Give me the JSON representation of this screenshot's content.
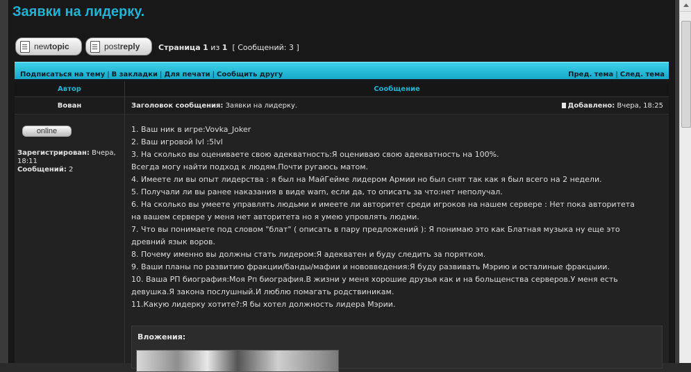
{
  "topic": {
    "title": "Заявки на лидерку."
  },
  "buttons": {
    "new_topic": {
      "prefix": "new",
      "bold": "topic"
    },
    "post_reply": {
      "prefix": "post",
      "bold": "reply"
    }
  },
  "pagination": {
    "page_word": "Страница",
    "current": "1",
    "of_word": "из",
    "total": "1",
    "messages": "[ Сообщений: 3 ]"
  },
  "navbar": {
    "left": [
      "Подписаться на тему",
      "В закладки",
      "Для печати",
      "Сообщить другу"
    ],
    "right": [
      "Пред. тема",
      "След. тема"
    ]
  },
  "table": {
    "header_author": "Автор",
    "header_message": "Сообщение"
  },
  "post": {
    "author": "Вован",
    "subject_label": "Заголовок сообщения:",
    "subject": "Заявки на лидерку.",
    "date_label": "Добавлено:",
    "date": "Вчера, 18:25",
    "online_status": "online",
    "registered_label": "Зарегистрирован:",
    "registered": "Вчера, 18:11",
    "messages_label": "Сообщений:",
    "messages": "2",
    "body": [
      "1. Ваш ник в игре:Vovka_Joker",
      "2. Ваш игровой lvl :5lvl",
      "3. На сколько вы оцениваете свою адекватность:Я оцениваю свою адекватность на 100%.",
      "Всегда могу найти подход к людям.Почти ругаюсь матом.",
      "4. Имеете ли вы опыт лидерства : я был на МайГейме лидером Армии но был снят так как я был всего на 2 недели.",
      "5. Получали ли вы ранее наказания в виде warn, если да, то описать за что:нет неполучал.",
      "6. На сколько вы умеете управлять людьми и имеете ли авторитет среди игроков на нашем сервере : Нет пока авторитета",
      "на вашем сервере у меня нет авторитета но я умею упровлять людми.",
      "7. Что вы понимаете под словом \"блат\" ( описать в пару предложений ): Я понимаю это как Блатная музыка ну еще это",
      "древний язык воров.",
      "8. Почему именно вы должны стать лидером:Я адекватен и буду следить за порятком.",
      "9. Ваши планы по развитию фракции/банды/мафии и нововведения:Я буду развивать Мэрию и осталиные фракцыии.",
      "10. Ваша РП биография:Моя Рп биография.В жизни у меня хорошие друзья как и на больщенства серверов.У меня есть",
      "девушка.Я закона послушный.И люблю помагать родствиникам.",
      "11.Какую лидерку хотите?:Я бы хотел должность лидера Мэрии."
    ],
    "attachments_title": "Вложения:"
  }
}
